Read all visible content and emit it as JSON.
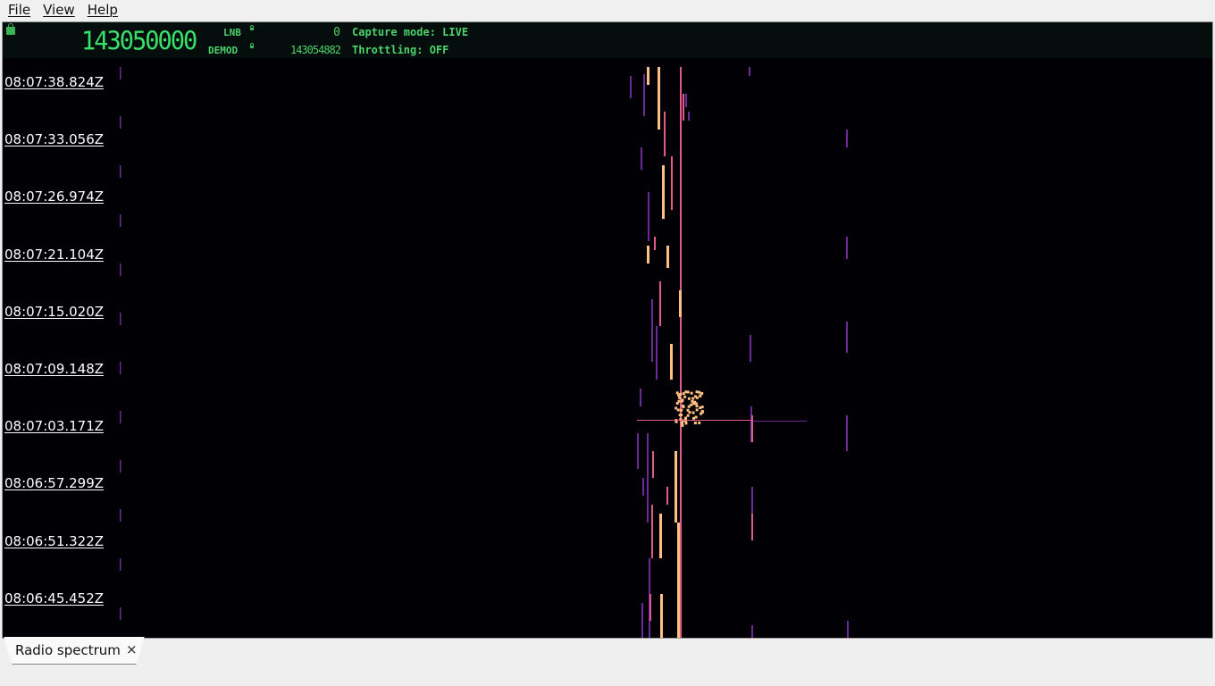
{
  "menu": [
    "File",
    "View",
    "Help"
  ],
  "status": {
    "main_frequency": "143050000",
    "lnb_label": "LNB",
    "lnb_value": "0",
    "demod_label": "DEMOD",
    "demod_value": "143054882",
    "capture_mode": "Capture mode: LIVE",
    "throttling": "Throttling: OFF"
  },
  "timestamps": [
    "08:07:38.824Z",
    "08:07:33.056Z",
    "08:07:26.974Z",
    "08:07:21.104Z",
    "08:07:15.020Z",
    "08:07:09.148Z",
    "08:07:03.171Z",
    "08:06:57.299Z",
    "08:06:51.322Z",
    "08:06:45.452Z"
  ],
  "tab": {
    "label": "Radio spectrum",
    "close_glyph": "×"
  },
  "colors": {
    "background": "#000005",
    "signal_hot": "#ffc080",
    "signal_warm": "#e05a8a",
    "signal_cool": "#6a2a9a",
    "status_text": "#4cd36b"
  }
}
